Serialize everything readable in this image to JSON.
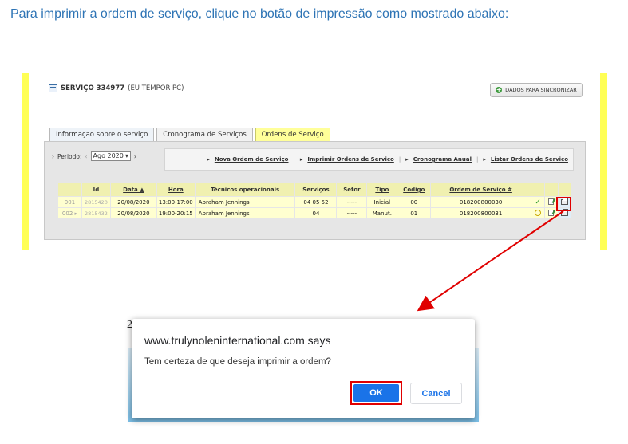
{
  "intro_text": "Para imprimir a ordem de serviço, clique no botão de impressão como mostrado abaixo:",
  "panel": {
    "service_title": "SERVIÇO 334977",
    "service_subtitle": "(EU TEMPOR PC)",
    "sync_button": "DADOS PARA SINCRONIZAR",
    "tabs": [
      "Informaçao sobre o serviço",
      "Cronograma de Serviços",
      "Ordens de Serviço"
    ],
    "active_tab": "Ordens de Serviço",
    "period_label": "Periodo:",
    "period_value": "Ago  2020",
    "nav_links": [
      "Nova Ordem de Serviço",
      "Imprimir Ordens de Serviço",
      "Cronograma Anual",
      "Listar Ordens de Serviço"
    ],
    "table": {
      "headers": [
        "",
        "Id",
        "Data ▲",
        "Hora",
        "Técnicos operacionais",
        "Serviços",
        "Setor",
        "Tipo",
        "Codigo",
        "Ordem de Serviço #",
        "",
        "",
        ""
      ],
      "rows": [
        {
          "num": "001",
          "id": "2815420",
          "date": "20/08/2020",
          "time": "13:00-17:00",
          "tech": "Abraham Jennings",
          "services": "04 05 52",
          "sector": "-----",
          "type": "Inicial",
          "code": "00",
          "order": "018200800030",
          "status": "done"
        },
        {
          "num": "002",
          "id": "2815432",
          "date": "20/08/2020",
          "time": "19:00-20:15",
          "tech": "Abraham Jennings",
          "services": "04",
          "sector": "-----",
          "type": "Manut.",
          "code": "01",
          "order": "018200800031",
          "status": "pending"
        }
      ]
    }
  },
  "dialog": {
    "title": "www.trulynoleninternational.com says",
    "message": "Tem certeza de que deseja imprimir a ordem?",
    "ok": "OK",
    "cancel": "Cancel"
  },
  "background_digit": "2",
  "colors": {
    "highlight": "#e00000",
    "accent_yellow": "#ffff55",
    "primary_blue": "#1a73e8"
  }
}
